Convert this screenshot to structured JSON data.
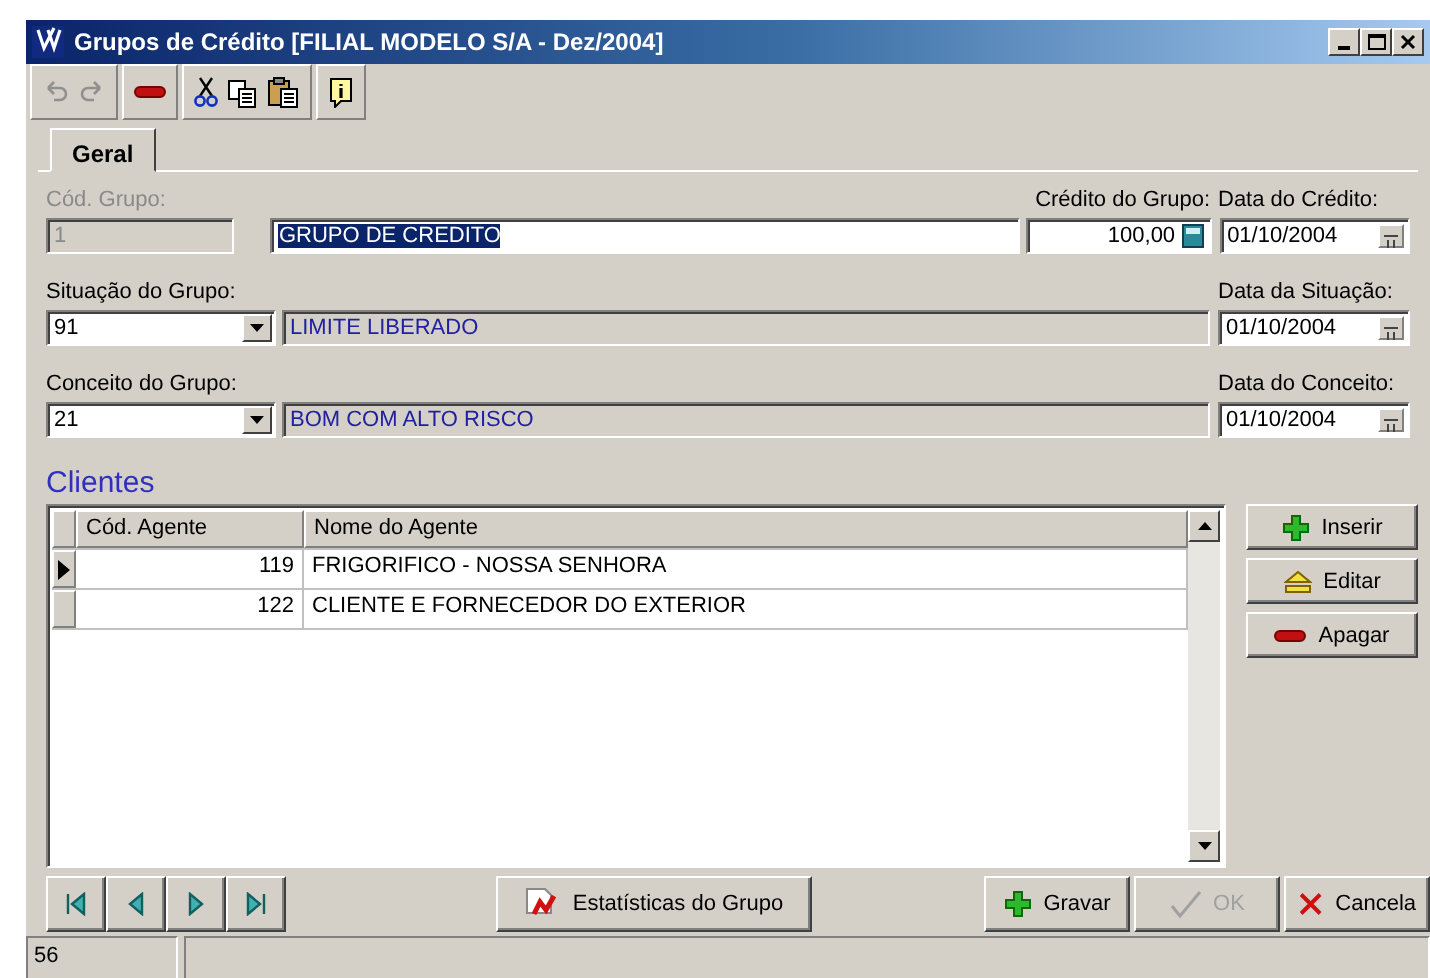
{
  "window": {
    "title": "Grupos de Crédito [FILIAL MODELO S/A - Dez/2004]"
  },
  "tabs": [
    {
      "label": "Geral",
      "selected": true
    }
  ],
  "form": {
    "group_code": {
      "label": "Cód. Grupo:",
      "value": "1",
      "disabled": true
    },
    "group_name": {
      "value": "GRUPO DE CREDITO",
      "highlighted": true
    },
    "group_credit": {
      "label": "Crédito do Grupo:",
      "value": "100,00"
    },
    "credit_date": {
      "label": "Data do Crédito:",
      "value": "01/10/2004"
    },
    "lookups": [
      {
        "label": "Situação do Grupo:",
        "code": "91",
        "description": "LIMITE LIBERADO",
        "date_label": "Data da Situação:",
        "date": "01/10/2004"
      },
      {
        "label": "Conceito do Grupo:",
        "code": "21",
        "description": "BOM COM ALTO RISCO",
        "date_label": "Data do Conceito:",
        "date": "01/10/2004"
      }
    ]
  },
  "clients": {
    "title": "Clientes",
    "columns": [
      "Cód. Agente",
      "Nome do Agente"
    ],
    "rows": [
      {
        "code": "119",
        "name": "FRIGORIFICO - NOSSA SENHORA",
        "selected": true
      },
      {
        "code": "122",
        "name": "CLIENTE E FORNECEDOR DO EXTERIOR",
        "selected": false
      }
    ]
  },
  "side_buttons": [
    {
      "label": "Inserir",
      "kind": "insert"
    },
    {
      "label": "Editar",
      "kind": "edit"
    },
    {
      "label": "Apagar",
      "kind": "delete"
    }
  ],
  "bottom_buttons": [
    {
      "label": "Gravar",
      "kind": "save",
      "disabled": false
    },
    {
      "label": "OK",
      "kind": "ok",
      "disabled": true
    },
    {
      "label": "Cancela",
      "kind": "cancel",
      "disabled": false
    }
  ],
  "stats_button": {
    "label": "Estatísticas do Grupo"
  },
  "status_bar": {
    "record": "56"
  }
}
